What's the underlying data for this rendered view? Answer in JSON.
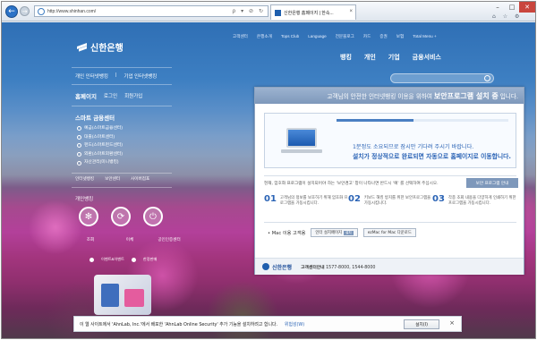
{
  "browser": {
    "url": "http://www.shinhan.com/",
    "tab_title": "신한은행 홈페이지 | 한속...",
    "minimize_glyph": "–",
    "maximize_glyph": "□",
    "close_glyph": "✕",
    "back_glyph": "←",
    "forward_glyph": "→",
    "addr_icons": "ρ ▾ ⊘ ↻",
    "tab_close_glyph": "×",
    "toolbar_icons": "⌂ ☆ ⚙"
  },
  "site": {
    "logo_text": "신한은행",
    "top_links": [
      "고객센터",
      "은행소개",
      "Tops Club",
      "Language",
      "전문블로그",
      "카드",
      "증권",
      "보험",
      "Total Menu +"
    ],
    "main_menu": [
      "뱅킹",
      "개인",
      "기업",
      "금융서비스"
    ],
    "banking_links": [
      "개인 인터넷뱅킹",
      "기업 인터넷뱅킹"
    ],
    "homepage_row": {
      "title": "홈페이지",
      "login": "로그인",
      "join": "회원가입"
    },
    "smart_title": "스마트 금융센터",
    "smart_items": [
      "예금(스마트금융센터)",
      "대출(스마트센터)",
      "펀드(스마트펀드센터)",
      "외환(스마트외환센터)",
      "자산관리(미니뱅킹)"
    ],
    "small_links": [
      "인터넷뱅킹",
      "보안센터",
      "사이버점포"
    ],
    "personal_bank": "개인뱅킹",
    "circle_labels": [
      "조회",
      "이체",
      "공인인증센터"
    ],
    "promo_labels": [
      "이벤트&이벤트",
      "한정판매"
    ]
  },
  "dialog": {
    "header_prefix": "고객님의 안전한 인터넷뱅킹 이용을 위하여",
    "header_bold": "보안프로그램 설치 중",
    "header_suffix": "입니다.",
    "progress": 0.45,
    "msg1": "1분정도 소요되므로 잠시만 기다려 주시기 바랍니다.",
    "msg2": "설치가 정상적으로 완료되면 자동으로 홈페이지로 이동합니다.",
    "note": "현재, 암호화 프로그램이 설치되어야 하는 '보안경고' 창이 나타나면 반드시 '예' 를 선택하여 주십시오.",
    "note_button": "보안 프로그램 안내",
    "steps": [
      {
        "num": "01",
        "text": "고객님의 정보를 보호하기 위해 암호화 프로그램을 가동시킵니다."
      },
      {
        "num": "02",
        "text": "키보드 해킹 방지를 위한 보안프로그램을 가동시킵니다."
      },
      {
        "num": "03",
        "text": "각종 조회 내용을 다양하게 인쇄하기 위한 프로그램을 가동시킵니다."
      }
    ],
    "mac_label": "• Mac 이용 고객용",
    "mac_btn1": "인터 설치페이지",
    "mac_btn1_tag": "설치",
    "mac_btn2": "ezMac for Mac 다운로드",
    "footer_logo": "신한은행",
    "footer_tel_label": "고객센터안내",
    "footer_tel": "1577-8000, 1544-8000"
  },
  "notification": {
    "text": "이 웹 사이트에서 'AhnLab, Inc.'에서 배포한 'AhnLab Online Security' 추가 기능을 설치하려고 합니다.",
    "link": "위험성(W)",
    "button": "설치(I)",
    "close": "×"
  },
  "colors": {
    "accent_blue": "#2a63b5",
    "dialog_header": "#7e98bb",
    "close_red": "#c9463d"
  }
}
